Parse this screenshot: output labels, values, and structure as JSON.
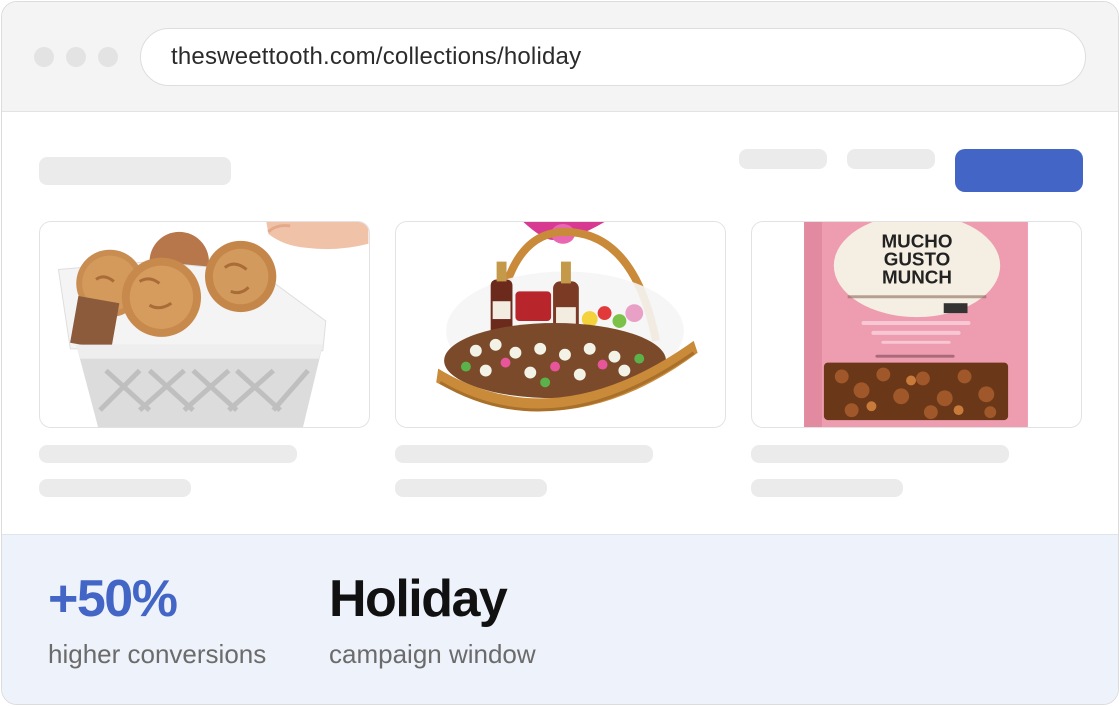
{
  "browser": {
    "url": "thesweettooth.com/collections/holiday"
  },
  "header": {
    "cta_color": "#4265c6"
  },
  "products": [
    {
      "image": "cookie-basket-image"
    },
    {
      "image": "gift-basket-image"
    },
    {
      "image": "snack-bag-image",
      "package_text": [
        "MUCHO",
        "GUSTO",
        "MUNCH"
      ]
    }
  ],
  "stats": [
    {
      "value": "+50%",
      "label": "higher conversions",
      "color": "#4265c6"
    },
    {
      "value": "Holiday",
      "label": "campaign window",
      "color": "#111111"
    }
  ]
}
